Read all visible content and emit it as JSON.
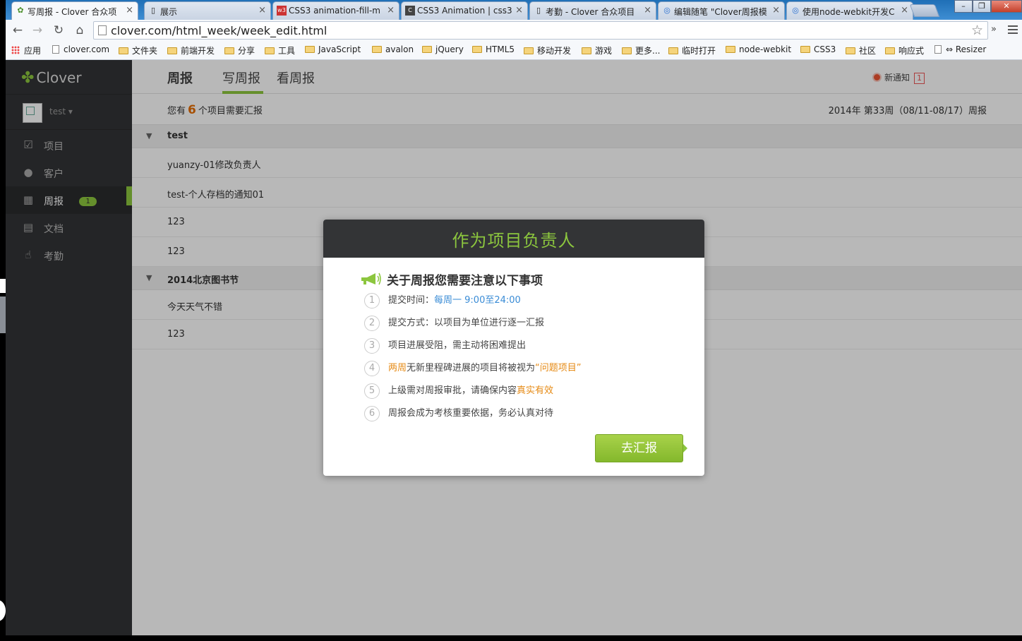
{
  "browser": {
    "tabs": [
      {
        "title": "写周报 - Clover 合众项",
        "active": true
      },
      {
        "title": "展示",
        "active": false
      },
      {
        "title": "CSS3 animation-fill-m",
        "active": false
      },
      {
        "title": "CSS3 Animation | css3",
        "active": false
      },
      {
        "title": "考勤 - Clover 合众项目",
        "active": false
      },
      {
        "title": "编辑随笔 \"Clover周报模",
        "active": false
      },
      {
        "title": "使用node-webkit开发C",
        "active": false
      }
    ],
    "url": "clover.com/html_week/week_edit.html",
    "bookmarks": [
      "应用",
      "clover.com",
      "文件夹",
      "前端开发",
      "分享",
      "工具",
      "JavaScript",
      "avalon",
      "jQuery",
      "HTML5",
      "移动开发",
      "游戏",
      "更多...",
      "临时打开",
      "node-webkit",
      "CSS3",
      "社区",
      "响应式",
      "Resizer"
    ]
  },
  "sidebar": {
    "brand": "Clover",
    "username": "test",
    "items": [
      {
        "label": "项目",
        "icon": "checkbox-icon"
      },
      {
        "label": "客户",
        "icon": "person-icon"
      },
      {
        "label": "周报",
        "icon": "calendar-icon",
        "badge": "1"
      },
      {
        "label": "文档",
        "icon": "document-icon"
      },
      {
        "label": "考勤",
        "icon": "fingerprint-icon"
      }
    ]
  },
  "header": {
    "section": "周报",
    "tab_write": "写周报",
    "tab_view": "看周报",
    "notify_label": "新通知",
    "notify_count": "1"
  },
  "summary": {
    "prefix": "您有",
    "count": "6",
    "suffix": "个项目需要汇报",
    "period": "2014年 第33周（08/11-08/17）周报"
  },
  "groups": [
    {
      "name": "test",
      "items": [
        "yuanzy-01修改负责人",
        "test-个人存档的通知01",
        "123",
        "123"
      ]
    },
    {
      "name": "2014北京图书节",
      "items": [
        "今天天气不错",
        "123"
      ]
    }
  ],
  "dialog": {
    "header": "作为项目负责人",
    "title": "关于周报您需要注意以下事项",
    "tips": [
      {
        "num": "1",
        "parts": [
          "提交时间：",
          "每周一 9:00至24:00",
          ""
        ]
      },
      {
        "num": "2",
        "parts": [
          "提交方式：以项目为单位进行逐一汇报",
          "",
          ""
        ]
      },
      {
        "num": "3",
        "parts": [
          "项目进展受阻，需主动将困难提出",
          "",
          ""
        ]
      },
      {
        "num": "4",
        "parts": [
          "两周",
          "无新里程碑进展的项目将被视为",
          "“问题项目”"
        ]
      },
      {
        "num": "5",
        "parts": [
          "上级需对周报审批，请确保内容",
          "真实有效",
          ""
        ]
      },
      {
        "num": "6",
        "parts": [
          "周报会成为考核重要依据，务必认真对待",
          "",
          ""
        ]
      }
    ],
    "button": "去汇报"
  },
  "colors": {
    "accent": "#8cc63e",
    "sidebar": "#333436",
    "orange": "#e68a14",
    "blue": "#3a8cd6"
  }
}
